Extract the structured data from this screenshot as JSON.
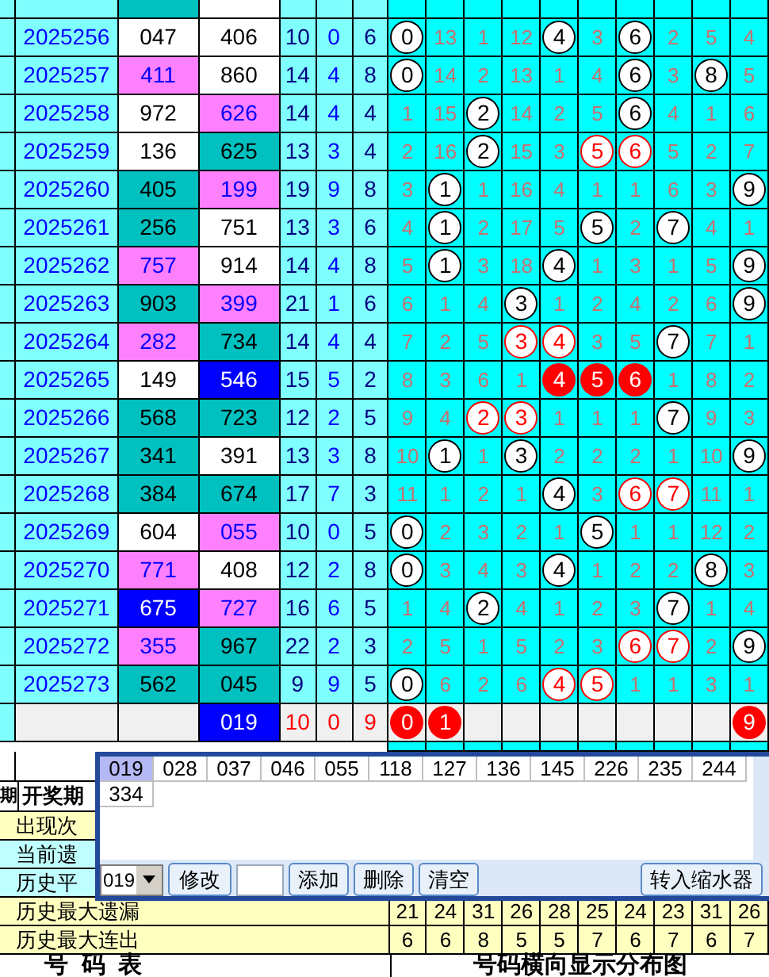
{
  "rows": [
    {
      "kind": "draw",
      "issue": "2025256",
      "a": {
        "text": "047",
        "color": "#ffffff"
      },
      "b": {
        "text": "406",
        "color": "#ffffff"
      },
      "sum": "10",
      "span": "0",
      "tail": "6",
      "cells": [
        {
          "kind": "ball",
          "text": "0"
        },
        {
          "kind": "plain",
          "text": "13"
        },
        {
          "kind": "plain",
          "text": "1"
        },
        {
          "kind": "plain",
          "text": "12"
        },
        {
          "kind": "ball",
          "text": "4"
        },
        {
          "kind": "plain",
          "text": "3"
        },
        {
          "kind": "ball",
          "text": "6"
        },
        {
          "kind": "plain",
          "text": "2"
        },
        {
          "kind": "plain",
          "text": "5"
        },
        {
          "kind": "plain",
          "text": "4"
        }
      ]
    },
    {
      "kind": "draw",
      "issue": "2025257",
      "a": {
        "text": "411",
        "color": "#ff80ff"
      },
      "b": {
        "text": "860",
        "color": "#ffffff"
      },
      "sum": "14",
      "span": "4",
      "tail": "8",
      "cells": [
        {
          "kind": "ball",
          "text": "0"
        },
        {
          "kind": "plain",
          "text": "14"
        },
        {
          "kind": "plain",
          "text": "2"
        },
        {
          "kind": "plain",
          "text": "13"
        },
        {
          "kind": "plain",
          "text": "1"
        },
        {
          "kind": "plain",
          "text": "4"
        },
        {
          "kind": "ball",
          "text": "6"
        },
        {
          "kind": "plain",
          "text": "3"
        },
        {
          "kind": "ball",
          "text": "8"
        },
        {
          "kind": "plain",
          "text": "5"
        }
      ]
    },
    {
      "kind": "draw",
      "issue": "2025258",
      "a": {
        "text": "972",
        "color": "#ffffff"
      },
      "b": {
        "text": "626",
        "color": "#ff80ff"
      },
      "sum": "14",
      "span": "4",
      "tail": "4",
      "cells": [
        {
          "kind": "plain",
          "text": "1"
        },
        {
          "kind": "plain",
          "text": "15"
        },
        {
          "kind": "ball",
          "text": "2"
        },
        {
          "kind": "plain",
          "text": "14"
        },
        {
          "kind": "plain",
          "text": "2"
        },
        {
          "kind": "plain",
          "text": "5"
        },
        {
          "kind": "ball",
          "text": "6"
        },
        {
          "kind": "plain",
          "text": "4"
        },
        {
          "kind": "plain",
          "text": "1"
        },
        {
          "kind": "plain",
          "text": "6"
        }
      ]
    },
    {
      "kind": "draw",
      "issue": "2025259",
      "a": {
        "text": "136",
        "color": "#ffffff"
      },
      "b": {
        "text": "625",
        "color": "#00c0c0"
      },
      "sum": "13",
      "span": "3",
      "tail": "4",
      "cells": [
        {
          "kind": "plain",
          "text": "2"
        },
        {
          "kind": "plain",
          "text": "16"
        },
        {
          "kind": "ball",
          "text": "2"
        },
        {
          "kind": "plain",
          "text": "15"
        },
        {
          "kind": "plain",
          "text": "3"
        },
        {
          "kind": "ball-red",
          "text": "5"
        },
        {
          "kind": "ball-red",
          "text": "6"
        },
        {
          "kind": "plain",
          "text": "5"
        },
        {
          "kind": "plain",
          "text": "2"
        },
        {
          "kind": "plain",
          "text": "7"
        }
      ]
    },
    {
      "kind": "draw",
      "issue": "2025260",
      "a": {
        "text": "405",
        "color": "#00c0c0"
      },
      "b": {
        "text": "199",
        "color": "#ff80ff"
      },
      "sum": "19",
      "span": "9",
      "tail": "8",
      "cells": [
        {
          "kind": "plain",
          "text": "3"
        },
        {
          "kind": "ball",
          "text": "1"
        },
        {
          "kind": "plain",
          "text": "1"
        },
        {
          "kind": "plain",
          "text": "16"
        },
        {
          "kind": "plain",
          "text": "4"
        },
        {
          "kind": "plain",
          "text": "1"
        },
        {
          "kind": "plain",
          "text": "1"
        },
        {
          "kind": "plain",
          "text": "6"
        },
        {
          "kind": "plain",
          "text": "3"
        },
        {
          "kind": "ball",
          "text": "9"
        }
      ]
    },
    {
      "kind": "draw",
      "issue": "2025261",
      "a": {
        "text": "256",
        "color": "#00c0c0"
      },
      "b": {
        "text": "751",
        "color": "#ffffff"
      },
      "sum": "13",
      "span": "3",
      "tail": "6",
      "cells": [
        {
          "kind": "plain",
          "text": "4"
        },
        {
          "kind": "ball",
          "text": "1"
        },
        {
          "kind": "plain",
          "text": "2"
        },
        {
          "kind": "plain",
          "text": "17"
        },
        {
          "kind": "plain",
          "text": "5"
        },
        {
          "kind": "ball",
          "text": "5"
        },
        {
          "kind": "plain",
          "text": "2"
        },
        {
          "kind": "ball",
          "text": "7"
        },
        {
          "kind": "plain",
          "text": "4"
        },
        {
          "kind": "plain",
          "text": "1"
        }
      ]
    },
    {
      "kind": "draw",
      "issue": "2025262",
      "a": {
        "text": "757",
        "color": "#ff80ff"
      },
      "b": {
        "text": "914",
        "color": "#ffffff"
      },
      "sum": "14",
      "span": "4",
      "tail": "8",
      "cells": [
        {
          "kind": "plain",
          "text": "5"
        },
        {
          "kind": "ball",
          "text": "1"
        },
        {
          "kind": "plain",
          "text": "3"
        },
        {
          "kind": "plain",
          "text": "18"
        },
        {
          "kind": "ball",
          "text": "4"
        },
        {
          "kind": "plain",
          "text": "1"
        },
        {
          "kind": "plain",
          "text": "3"
        },
        {
          "kind": "plain",
          "text": "1"
        },
        {
          "kind": "plain",
          "text": "5"
        },
        {
          "kind": "ball",
          "text": "9"
        }
      ]
    },
    {
      "kind": "draw",
      "issue": "2025263",
      "a": {
        "text": "903",
        "color": "#00c0c0"
      },
      "b": {
        "text": "399",
        "color": "#ff80ff"
      },
      "sum": "21",
      "span": "1",
      "tail": "6",
      "cells": [
        {
          "kind": "plain",
          "text": "6"
        },
        {
          "kind": "plain",
          "text": "1"
        },
        {
          "kind": "plain",
          "text": "4"
        },
        {
          "kind": "ball",
          "text": "3"
        },
        {
          "kind": "plain",
          "text": "1"
        },
        {
          "kind": "plain",
          "text": "2"
        },
        {
          "kind": "plain",
          "text": "4"
        },
        {
          "kind": "plain",
          "text": "2"
        },
        {
          "kind": "plain",
          "text": "6"
        },
        {
          "kind": "ball",
          "text": "9"
        }
      ]
    },
    {
      "kind": "draw",
      "issue": "2025264",
      "a": {
        "text": "282",
        "color": "#ff80ff"
      },
      "b": {
        "text": "734",
        "color": "#00c0c0"
      },
      "sum": "14",
      "span": "4",
      "tail": "4",
      "cells": [
        {
          "kind": "plain",
          "text": "7"
        },
        {
          "kind": "plain",
          "text": "2"
        },
        {
          "kind": "plain",
          "text": "5"
        },
        {
          "kind": "ball-red",
          "text": "3"
        },
        {
          "kind": "ball-red",
          "text": "4"
        },
        {
          "kind": "plain",
          "text": "3"
        },
        {
          "kind": "plain",
          "text": "5"
        },
        {
          "kind": "ball",
          "text": "7"
        },
        {
          "kind": "plain",
          "text": "7"
        },
        {
          "kind": "plain",
          "text": "1"
        }
      ]
    },
    {
      "kind": "draw",
      "issue": "2025265",
      "a": {
        "text": "149",
        "color": "#ffffff"
      },
      "b": {
        "text": "546",
        "color": "#0000ff"
      },
      "sum": "15",
      "span": "5",
      "tail": "2",
      "cells": [
        {
          "kind": "plain",
          "text": "8"
        },
        {
          "kind": "plain",
          "text": "3"
        },
        {
          "kind": "plain",
          "text": "6"
        },
        {
          "kind": "plain",
          "text": "1"
        },
        {
          "kind": "ball-solid",
          "text": "4"
        },
        {
          "kind": "ball-solid",
          "text": "5"
        },
        {
          "kind": "ball-solid",
          "text": "6"
        },
        {
          "kind": "plain",
          "text": "1"
        },
        {
          "kind": "plain",
          "text": "8"
        },
        {
          "kind": "plain",
          "text": "2"
        }
      ]
    },
    {
      "kind": "draw",
      "issue": "2025266",
      "a": {
        "text": "568",
        "color": "#00c0c0"
      },
      "b": {
        "text": "723",
        "color": "#00c0c0"
      },
      "sum": "12",
      "span": "2",
      "tail": "5",
      "cells": [
        {
          "kind": "plain",
          "text": "9"
        },
        {
          "kind": "plain",
          "text": "4"
        },
        {
          "kind": "ball-red",
          "text": "2"
        },
        {
          "kind": "ball-red",
          "text": "3"
        },
        {
          "kind": "plain",
          "text": "1"
        },
        {
          "kind": "plain",
          "text": "1"
        },
        {
          "kind": "plain",
          "text": "1"
        },
        {
          "kind": "ball",
          "text": "7"
        },
        {
          "kind": "plain",
          "text": "9"
        },
        {
          "kind": "plain",
          "text": "3"
        }
      ]
    },
    {
      "kind": "draw",
      "issue": "2025267",
      "a": {
        "text": "341",
        "color": "#00c0c0"
      },
      "b": {
        "text": "391",
        "color": "#ffffff"
      },
      "sum": "13",
      "span": "3",
      "tail": "8",
      "cells": [
        {
          "kind": "plain",
          "text": "10"
        },
        {
          "kind": "ball",
          "text": "1"
        },
        {
          "kind": "plain",
          "text": "1"
        },
        {
          "kind": "ball",
          "text": "3"
        },
        {
          "kind": "plain",
          "text": "2"
        },
        {
          "kind": "plain",
          "text": "2"
        },
        {
          "kind": "plain",
          "text": "2"
        },
        {
          "kind": "plain",
          "text": "1"
        },
        {
          "kind": "plain",
          "text": "10"
        },
        {
          "kind": "ball",
          "text": "9"
        }
      ]
    },
    {
      "kind": "draw",
      "issue": "2025268",
      "a": {
        "text": "384",
        "color": "#00c0c0"
      },
      "b": {
        "text": "674",
        "color": "#00c0c0"
      },
      "sum": "17",
      "span": "7",
      "tail": "3",
      "cells": [
        {
          "kind": "plain",
          "text": "11"
        },
        {
          "kind": "plain",
          "text": "1"
        },
        {
          "kind": "plain",
          "text": "2"
        },
        {
          "kind": "plain",
          "text": "1"
        },
        {
          "kind": "ball",
          "text": "4"
        },
        {
          "kind": "plain",
          "text": "3"
        },
        {
          "kind": "ball-red",
          "text": "6"
        },
        {
          "kind": "ball-red",
          "text": "7"
        },
        {
          "kind": "plain",
          "text": "11"
        },
        {
          "kind": "plain",
          "text": "1"
        }
      ]
    },
    {
      "kind": "draw",
      "issue": "2025269",
      "a": {
        "text": "604",
        "color": "#ffffff"
      },
      "b": {
        "text": "055",
        "color": "#ff80ff"
      },
      "sum": "10",
      "span": "0",
      "tail": "5",
      "cells": [
        {
          "kind": "ball",
          "text": "0"
        },
        {
          "kind": "plain",
          "text": "2"
        },
        {
          "kind": "plain",
          "text": "3"
        },
        {
          "kind": "plain",
          "text": "2"
        },
        {
          "kind": "plain",
          "text": "1"
        },
        {
          "kind": "ball",
          "text": "5"
        },
        {
          "kind": "plain",
          "text": "1"
        },
        {
          "kind": "plain",
          "text": "1"
        },
        {
          "kind": "plain",
          "text": "12"
        },
        {
          "kind": "plain",
          "text": "2"
        }
      ]
    },
    {
      "kind": "draw",
      "issue": "2025270",
      "a": {
        "text": "771",
        "color": "#ff80ff"
      },
      "b": {
        "text": "408",
        "color": "#ffffff"
      },
      "sum": "12",
      "span": "2",
      "tail": "8",
      "cells": [
        {
          "kind": "ball",
          "text": "0"
        },
        {
          "kind": "plain",
          "text": "3"
        },
        {
          "kind": "plain",
          "text": "4"
        },
        {
          "kind": "plain",
          "text": "3"
        },
        {
          "kind": "ball",
          "text": "4"
        },
        {
          "kind": "plain",
          "text": "1"
        },
        {
          "kind": "plain",
          "text": "2"
        },
        {
          "kind": "plain",
          "text": "2"
        },
        {
          "kind": "ball",
          "text": "8"
        },
        {
          "kind": "plain",
          "text": "3"
        }
      ]
    },
    {
      "kind": "draw",
      "issue": "2025271",
      "a": {
        "text": "675",
        "color": "#0000ff"
      },
      "b": {
        "text": "727",
        "color": "#ff80ff"
      },
      "sum": "16",
      "span": "6",
      "tail": "5",
      "cells": [
        {
          "kind": "plain",
          "text": "1"
        },
        {
          "kind": "plain",
          "text": "4"
        },
        {
          "kind": "ball",
          "text": "2"
        },
        {
          "kind": "plain",
          "text": "4"
        },
        {
          "kind": "plain",
          "text": "1"
        },
        {
          "kind": "plain",
          "text": "2"
        },
        {
          "kind": "plain",
          "text": "3"
        },
        {
          "kind": "ball",
          "text": "7"
        },
        {
          "kind": "plain",
          "text": "1"
        },
        {
          "kind": "plain",
          "text": "4"
        }
      ]
    },
    {
      "kind": "draw",
      "issue": "2025272",
      "a": {
        "text": "355",
        "color": "#ff80ff"
      },
      "b": {
        "text": "967",
        "color": "#00c0c0"
      },
      "sum": "22",
      "span": "2",
      "tail": "3",
      "cells": [
        {
          "kind": "plain",
          "text": "2"
        },
        {
          "kind": "plain",
          "text": "5"
        },
        {
          "kind": "plain",
          "text": "1"
        },
        {
          "kind": "plain",
          "text": "5"
        },
        {
          "kind": "plain",
          "text": "2"
        },
        {
          "kind": "plain",
          "text": "3"
        },
        {
          "kind": "ball-red",
          "text": "6"
        },
        {
          "kind": "ball-red",
          "text": "7"
        },
        {
          "kind": "plain",
          "text": "2"
        },
        {
          "kind": "ball",
          "text": "9"
        }
      ]
    },
    {
      "kind": "draw",
      "issue": "2025273",
      "a": {
        "text": "562",
        "color": "#00c0c0"
      },
      "b": {
        "text": "045",
        "color": "#00c0c0"
      },
      "sum": "9",
      "span": "9",
      "tail": "5",
      "cells": [
        {
          "kind": "ball",
          "text": "0"
        },
        {
          "kind": "plain",
          "text": "6"
        },
        {
          "kind": "plain",
          "text": "2"
        },
        {
          "kind": "plain",
          "text": "6"
        },
        {
          "kind": "ball-red",
          "text": "4"
        },
        {
          "kind": "ball-red",
          "text": "5"
        },
        {
          "kind": "plain",
          "text": "1"
        },
        {
          "kind": "plain",
          "text": "1"
        },
        {
          "kind": "plain",
          "text": "3"
        },
        {
          "kind": "plain",
          "text": "1"
        }
      ]
    },
    {
      "kind": "forecast",
      "b": {
        "text": "019",
        "color": "#0000ff"
      },
      "sum": "10",
      "span": "0",
      "tail": "9",
      "cells": [
        {
          "kind": "ball-solid",
          "text": "0"
        },
        {
          "kind": "ball-solid",
          "text": "1"
        },
        {
          "kind": "empty"
        },
        {
          "kind": "empty"
        },
        {
          "kind": "empty"
        },
        {
          "kind": "empty"
        },
        {
          "kind": "empty"
        },
        {
          "kind": "empty"
        },
        {
          "kind": "empty"
        },
        {
          "kind": "ball-solid",
          "text": "9"
        }
      ]
    }
  ],
  "header": {
    "column_1": "期",
    "column_2": "开奖期"
  },
  "stats": [
    {
      "label": "出现次",
      "color": "#ffffc0"
    },
    {
      "label": "当前遗",
      "color": "#c0ffff"
    },
    {
      "label": "历史平",
      "color": "#c0ffff"
    },
    {
      "label": "历史最大遗漏",
      "color": "#ffffc0",
      "values": [
        "21",
        "24",
        "31",
        "26",
        "28",
        "25",
        "24",
        "23",
        "31",
        "26"
      ]
    },
    {
      "label": "历史最大连出",
      "color": "#ffffc0",
      "values": [
        "6",
        "6",
        "8",
        "5",
        "5",
        "7",
        "6",
        "7",
        "6",
        "7"
      ]
    }
  ],
  "footer": {
    "left": "号  码  表",
    "right": "号码横向显示分布图"
  },
  "popup": {
    "numbers": [
      {
        "text": "019",
        "selected": true
      },
      {
        "text": "028",
        "selected": false
      },
      {
        "text": "037",
        "selected": false
      },
      {
        "text": "046",
        "selected": false
      },
      {
        "text": "055",
        "selected": false
      },
      {
        "text": "118",
        "selected": false
      },
      {
        "text": "127",
        "selected": false
      },
      {
        "text": "136",
        "selected": false
      },
      {
        "text": "145",
        "selected": false
      },
      {
        "text": "226",
        "selected": false
      },
      {
        "text": "235",
        "selected": false
      },
      {
        "text": "244",
        "selected": false
      },
      {
        "text": "334",
        "selected": false
      }
    ],
    "combo": {
      "value": "019"
    },
    "buttons_left": [
      "修改"
    ],
    "buttons_mid": [
      "添加",
      "删除",
      "清空"
    ],
    "button_right": "转入缩水器"
  }
}
